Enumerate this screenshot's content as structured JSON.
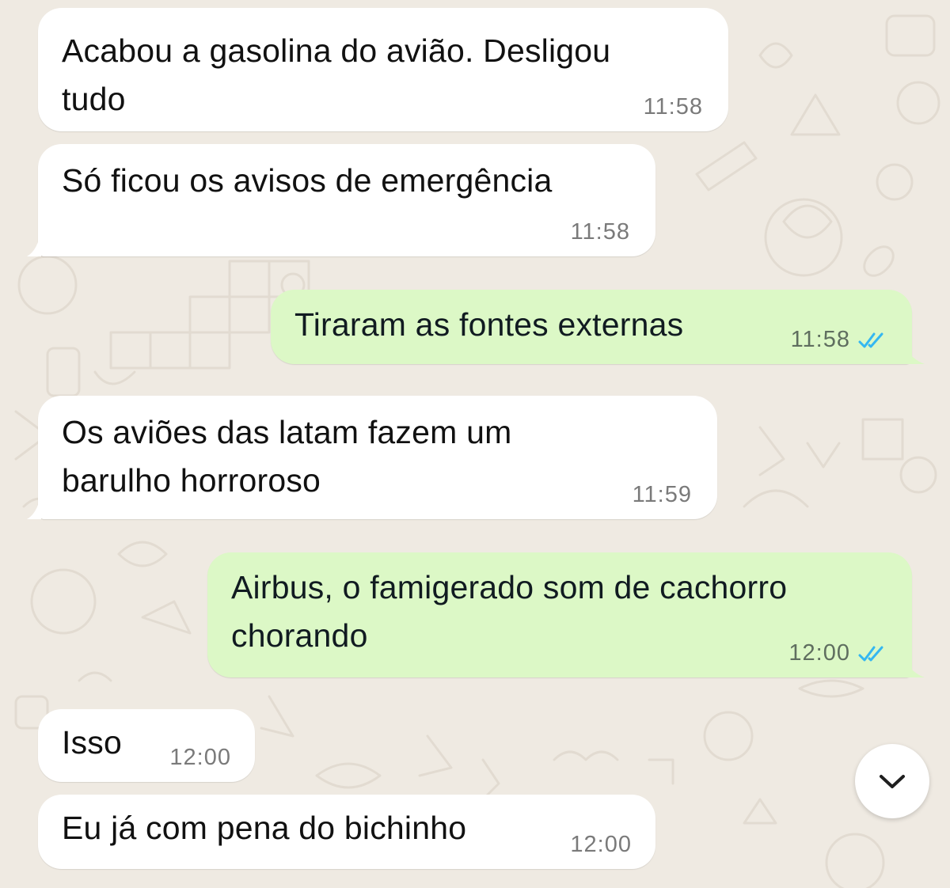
{
  "chat": {
    "messages": [
      {
        "direction": "incoming",
        "text": "Acabou a gasolina do avião. Desligou\ntudo",
        "time": "11:58"
      },
      {
        "direction": "incoming",
        "text": "Só ficou os avisos de emergência",
        "time": "11:58"
      },
      {
        "direction": "outgoing",
        "text": "Tiraram as fontes externas",
        "time": "11:58",
        "status": "read"
      },
      {
        "direction": "incoming",
        "text": "Os aviões das latam fazem um\nbarulho horroroso",
        "time": "11:59"
      },
      {
        "direction": "outgoing",
        "text": "Airbus, o famigerado som de cachorro\nchorando",
        "time": "12:00",
        "status": "read"
      },
      {
        "direction": "incoming",
        "text": "Isso",
        "time": "12:00"
      },
      {
        "direction": "incoming",
        "text": "Eu já com pena do bichinho",
        "time": "12:00"
      }
    ]
  },
  "icons": {
    "read_receipt": "double-check-icon",
    "scroll_down": "chevron-down-icon"
  },
  "colors": {
    "background": "#efeae2",
    "incoming_bubble": "#ffffff",
    "outgoing_bubble": "#dcf8c6",
    "read_tick": "#34b7f1"
  }
}
